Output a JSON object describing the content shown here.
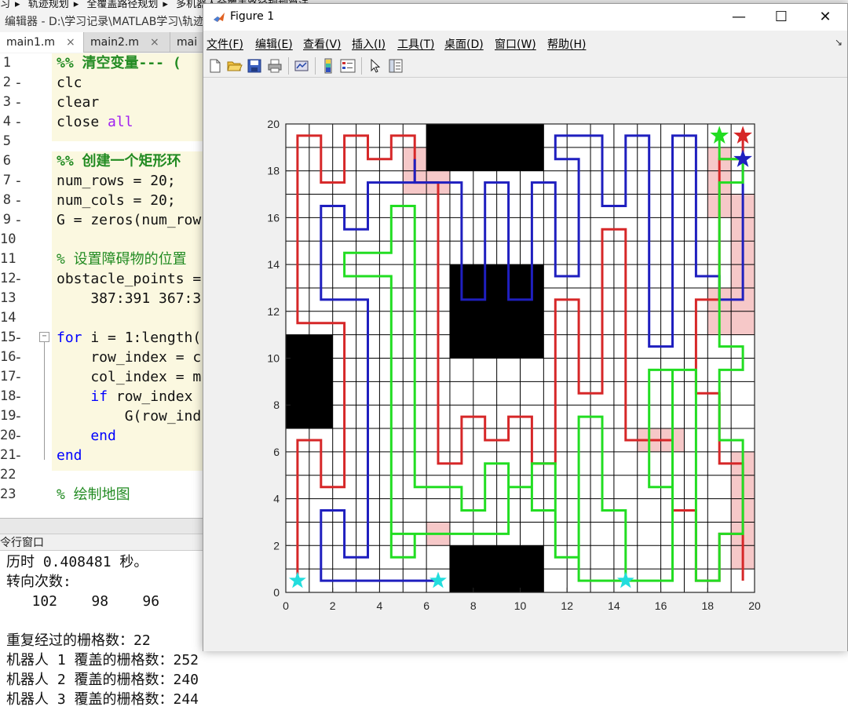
{
  "breadcrumb": [
    "习",
    "轨迹规划",
    "全覆盖路径规划",
    "多机器人全覆盖路径规划算法"
  ],
  "editor": {
    "title": "编辑器 - D:\\学习记录\\MATLAB学习\\轨迹规划",
    "tabs": [
      {
        "label": "main1.m",
        "close": "×"
      },
      {
        "label": "main2.m",
        "close": "×"
      },
      {
        "label": "mai"
      }
    ],
    "lines": [
      {
        "n": "1",
        "dash": "",
        "text": "%% 清空变量--- (",
        "cls": "comment bold"
      },
      {
        "n": "2",
        "dash": "-",
        "text": "clc",
        "cls": ""
      },
      {
        "n": "3",
        "dash": "-",
        "text": "clear",
        "cls": ""
      },
      {
        "n": "4",
        "dash": "-",
        "text": "close all",
        "cls": "closeall"
      },
      {
        "n": "5",
        "dash": "",
        "text": "",
        "cls": ""
      },
      {
        "n": "6",
        "dash": "",
        "text": "%% 创建一个矩形环",
        "cls": "comment bold"
      },
      {
        "n": "7",
        "dash": "-",
        "text": "num_rows = 20;",
        "cls": ""
      },
      {
        "n": "8",
        "dash": "-",
        "text": "num_cols = 20;",
        "cls": ""
      },
      {
        "n": "9",
        "dash": "-",
        "text": "G = zeros(num_row",
        "cls": ""
      },
      {
        "n": "10",
        "dash": "",
        "text": "",
        "cls": ""
      },
      {
        "n": "11",
        "dash": "",
        "text": "% 设置障碍物的位置",
        "cls": "comment"
      },
      {
        "n": "12",
        "dash": "-",
        "text": "obstacle_points =",
        "cls": ""
      },
      {
        "n": "13",
        "dash": "",
        "text": "    387:391 367:3",
        "cls": ""
      },
      {
        "n": "14",
        "dash": "",
        "text": "",
        "cls": ""
      },
      {
        "n": "15",
        "dash": "-",
        "text": "for i = 1:length(",
        "cls": "forline"
      },
      {
        "n": "16",
        "dash": "-",
        "text": "    row_index = c",
        "cls": ""
      },
      {
        "n": "17",
        "dash": "-",
        "text": "    col_index = m",
        "cls": ""
      },
      {
        "n": "18",
        "dash": "-",
        "text": "    if row_index",
        "cls": "ifline"
      },
      {
        "n": "19",
        "dash": "-",
        "text": "        G(row_ind",
        "cls": ""
      },
      {
        "n": "20",
        "dash": "-",
        "text": "    end",
        "cls": "kw"
      },
      {
        "n": "21",
        "dash": "-",
        "text": "end",
        "cls": "kw"
      },
      {
        "n": "22",
        "dash": "",
        "text": "",
        "cls": ""
      },
      {
        "n": "23",
        "dash": "",
        "text": "% 绘制地图",
        "cls": "comment"
      }
    ]
  },
  "command_window": {
    "title": "令行窗口",
    "lines": [
      "历时 0.408481 秒。",
      "转向次数:",
      "   102    98    96",
      "",
      "重复经过的栅格数：22",
      "机器人 1 覆盖的栅格数：252",
      "机器人 2 覆盖的栅格数：240",
      "机器人 3 覆盖的栅格数：244"
    ]
  },
  "figure": {
    "title": "Figure 1",
    "menus": [
      "文件(F)",
      "编辑(E)",
      "查看(V)",
      "插入(I)",
      "工具(T)",
      "桌面(D)",
      "窗口(W)",
      "帮助(H)"
    ],
    "toolbar_icons": [
      "new-figure-icon",
      "open-file-icon",
      "save-icon",
      "print-icon",
      "link-plot-icon",
      "colorbar-icon",
      "legend-icon",
      "pointer-icon",
      "property-inspector-icon"
    ]
  },
  "chart_data": {
    "type": "grid-map",
    "xlim": [
      0,
      20
    ],
    "ylim": [
      0,
      20
    ],
    "xticks": [
      0,
      2,
      4,
      6,
      8,
      10,
      12,
      14,
      16,
      18,
      20
    ],
    "yticks": [
      0,
      2,
      4,
      6,
      8,
      10,
      12,
      14,
      16,
      18,
      20
    ],
    "grid": true,
    "colors": {
      "robot1": "#d62728",
      "robot2": "#1f1fbf",
      "robot3": "#22dd22",
      "start": "#22dddd",
      "overlap": "#f6c8c8",
      "obstacle": "#000000"
    },
    "obstacles": [
      [
        6,
        18,
        5,
        2
      ],
      [
        7,
        10,
        4,
        4
      ],
      [
        0,
        7,
        2,
        4
      ],
      [
        7,
        0,
        4,
        2
      ]
    ],
    "overlap_cells": [
      [
        5,
        18
      ],
      [
        5,
        17
      ],
      [
        6,
        17
      ],
      [
        18,
        18
      ],
      [
        18,
        17
      ],
      [
        18,
        16
      ],
      [
        19,
        16
      ],
      [
        19,
        15
      ],
      [
        19,
        14
      ],
      [
        19,
        13
      ],
      [
        19,
        12
      ],
      [
        18,
        12
      ],
      [
        19,
        11
      ],
      [
        18,
        11
      ],
      [
        15,
        6
      ],
      [
        16,
        6
      ],
      [
        19,
        5
      ],
      [
        19,
        4
      ],
      [
        19,
        3
      ],
      [
        19,
        2
      ],
      [
        19,
        1
      ],
      [
        6,
        2
      ]
    ],
    "series": [
      {
        "color": "robot1",
        "start": [
          0.5,
          0.5
        ],
        "goal": [
          19.5,
          19.5
        ],
        "path": [
          [
            0.5,
            0.5
          ],
          [
            0.5,
            6.5
          ],
          [
            1.5,
            6.5
          ],
          [
            1.5,
            4.5
          ],
          [
            2.5,
            4.5
          ],
          [
            2.5,
            11.5
          ],
          [
            0.5,
            11.5
          ],
          [
            0.5,
            19.5
          ],
          [
            1.5,
            19.5
          ],
          [
            1.5,
            17.5
          ],
          [
            2.5,
            17.5
          ],
          [
            2.5,
            19.5
          ],
          [
            3.5,
            19.5
          ],
          [
            3.5,
            18.5
          ],
          [
            4.5,
            18.5
          ],
          [
            4.5,
            19.5
          ],
          [
            5.5,
            19.5
          ],
          [
            5.5,
            17.5
          ],
          [
            6.5,
            17.5
          ],
          [
            6.5,
            5.5
          ],
          [
            7.5,
            5.5
          ],
          [
            7.5,
            7.5
          ],
          [
            8.5,
            7.5
          ],
          [
            8.5,
            6.5
          ],
          [
            9.5,
            6.5
          ],
          [
            9.5,
            7.5
          ],
          [
            10.5,
            7.5
          ],
          [
            10.5,
            5.5
          ],
          [
            11.5,
            5.5
          ],
          [
            11.5,
            12.5
          ],
          [
            12.5,
            12.5
          ],
          [
            12.5,
            8.5
          ],
          [
            13.5,
            8.5
          ],
          [
            13.5,
            15.5
          ],
          [
            14.5,
            15.5
          ],
          [
            14.5,
            6.5
          ],
          [
            16.5,
            6.5
          ],
          [
            16.5,
            3.5
          ],
          [
            17.5,
            3.5
          ],
          [
            17.5,
            0.5
          ],
          [
            18.5,
            0.5
          ],
          [
            18.5,
            2.5
          ],
          [
            19.5,
            2.5
          ],
          [
            19.5,
            0.5
          ],
          [
            19.5,
            1.5
          ],
          [
            19.5,
            5.5
          ],
          [
            18.5,
            5.5
          ],
          [
            18.5,
            8.5
          ],
          [
            17.5,
            8.5
          ],
          [
            17.5,
            12.5
          ],
          [
            18.5,
            12.5
          ],
          [
            18.5,
            18.5
          ],
          [
            19.5,
            18.5
          ],
          [
            19.5,
            19.5
          ]
        ]
      },
      {
        "color": "robot2",
        "start": [
          6.5,
          0.5
        ],
        "goal": [
          19.5,
          18.5
        ],
        "path": [
          [
            6.5,
            0.5
          ],
          [
            1.5,
            0.5
          ],
          [
            1.5,
            3.5
          ],
          [
            2.5,
            3.5
          ],
          [
            2.5,
            1.5
          ],
          [
            3.5,
            1.5
          ],
          [
            3.5,
            12.5
          ],
          [
            1.5,
            12.5
          ],
          [
            1.5,
            16.5
          ],
          [
            2.5,
            16.5
          ],
          [
            2.5,
            15.5
          ],
          [
            3.5,
            15.5
          ],
          [
            3.5,
            17.5
          ],
          [
            5.5,
            17.5
          ],
          [
            5.5,
            18.5
          ],
          [
            5.5,
            17.5
          ],
          [
            7.5,
            17.5
          ],
          [
            7.5,
            12.5
          ],
          [
            8.5,
            12.5
          ],
          [
            8.5,
            17.5
          ],
          [
            9.5,
            17.5
          ],
          [
            9.5,
            12.5
          ],
          [
            10.5,
            12.5
          ],
          [
            10.5,
            17.5
          ],
          [
            11.5,
            17.5
          ],
          [
            11.5,
            13.5
          ],
          [
            12.5,
            13.5
          ],
          [
            12.5,
            18.5
          ],
          [
            11.5,
            18.5
          ],
          [
            11.5,
            19.5
          ],
          [
            13.5,
            19.5
          ],
          [
            13.5,
            16.5
          ],
          [
            14.5,
            16.5
          ],
          [
            14.5,
            19.5
          ],
          [
            15.5,
            19.5
          ],
          [
            15.5,
            10.5
          ],
          [
            16.5,
            10.5
          ],
          [
            16.5,
            19.5
          ],
          [
            17.5,
            19.5
          ],
          [
            17.5,
            13.5
          ],
          [
            18.5,
            13.5
          ],
          [
            18.5,
            12.5
          ],
          [
            19.5,
            12.5
          ],
          [
            19.5,
            18.5
          ]
        ]
      },
      {
        "color": "robot3",
        "start": [
          14.5,
          0.5
        ],
        "goal": [
          18.5,
          19.5
        ],
        "path": [
          [
            14.5,
            0.5
          ],
          [
            12.5,
            0.5
          ],
          [
            12.5,
            1.5
          ],
          [
            11.5,
            1.5
          ],
          [
            11.5,
            3.5
          ],
          [
            10.5,
            3.5
          ],
          [
            10.5,
            4.5
          ],
          [
            9.5,
            4.5
          ],
          [
            9.5,
            2.5
          ],
          [
            4.5,
            2.5
          ],
          [
            4.5,
            1.5
          ],
          [
            5.5,
            1.5
          ],
          [
            5.5,
            2.5
          ],
          [
            4.5,
            2.5
          ],
          [
            4.5,
            13.5
          ],
          [
            2.5,
            13.5
          ],
          [
            2.5,
            14.5
          ],
          [
            4.5,
            14.5
          ],
          [
            4.5,
            16.5
          ],
          [
            5.5,
            16.5
          ],
          [
            5.5,
            4.5
          ],
          [
            7.5,
            4.5
          ],
          [
            7.5,
            3.5
          ],
          [
            8.5,
            3.5
          ],
          [
            8.5,
            5.5
          ],
          [
            9.5,
            5.5
          ],
          [
            9.5,
            4.5
          ],
          [
            10.5,
            4.5
          ],
          [
            10.5,
            5.5
          ],
          [
            11.5,
            5.5
          ],
          [
            11.5,
            1.5
          ],
          [
            12.5,
            1.5
          ],
          [
            12.5,
            7.5
          ],
          [
            13.5,
            7.5
          ],
          [
            13.5,
            3.5
          ],
          [
            14.5,
            3.5
          ],
          [
            14.5,
            0.5
          ],
          [
            16.5,
            0.5
          ],
          [
            16.5,
            9.5
          ],
          [
            15.5,
            9.5
          ],
          [
            15.5,
            4.5
          ],
          [
            16.5,
            4.5
          ],
          [
            16.5,
            9.5
          ],
          [
            17.5,
            9.5
          ],
          [
            17.5,
            0.5
          ],
          [
            18.5,
            0.5
          ],
          [
            18.5,
            2.5
          ],
          [
            19.5,
            2.5
          ],
          [
            19.5,
            6.5
          ],
          [
            18.5,
            6.5
          ],
          [
            18.5,
            9.5
          ],
          [
            19.5,
            9.5
          ],
          [
            19.5,
            10.5
          ],
          [
            18.5,
            10.5
          ],
          [
            18.5,
            17.5
          ],
          [
            19.5,
            17.5
          ],
          [
            19.5,
            18.5
          ],
          [
            18.5,
            18.5
          ],
          [
            18.5,
            19.5
          ]
        ]
      }
    ]
  }
}
